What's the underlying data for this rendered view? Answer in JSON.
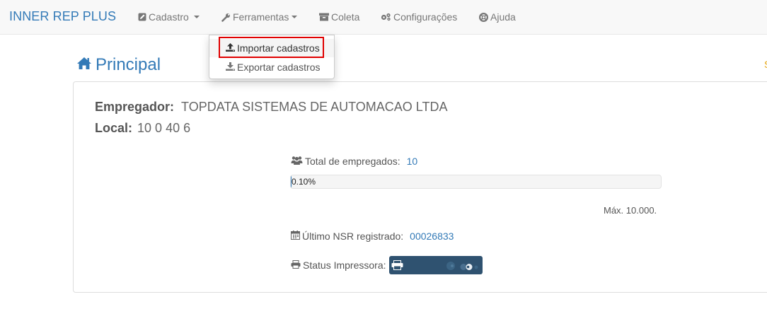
{
  "navbar": {
    "brand": "INNER REP PLUS",
    "items": [
      {
        "label": "Cadastro",
        "icon": "edit-icon",
        "has_caret": true
      },
      {
        "label": "Ferramentas",
        "icon": "wrench-icon",
        "has_caret": true
      },
      {
        "label": "Coleta",
        "icon": "archive-icon",
        "has_caret": false
      },
      {
        "label": "Configurações",
        "icon": "gears-icon",
        "has_caret": false
      },
      {
        "label": "Ajuda",
        "icon": "lifebuoy-icon",
        "has_caret": false
      }
    ]
  },
  "dropdown": {
    "items": [
      {
        "label": "Importar cadastros",
        "icon": "upload-icon",
        "highlighted": true
      },
      {
        "label": "Exportar cadastros",
        "icon": "download-icon",
        "highlighted": false
      }
    ]
  },
  "page": {
    "title": "Principal",
    "title_icon": "home-icon"
  },
  "panel": {
    "empregador_label": "Empregador:",
    "empregador_value": "TOPDATA SISTEMAS DE AUTOMACAO LTDA",
    "local_label": "Local:",
    "local_value": "10 0 40 6",
    "total_label": "Total de empregados:",
    "total_value": "10",
    "progress_text": "0.10%",
    "progress_fraction": 0.001,
    "max_text": "Máx. 10.000.",
    "nsr_label": "Último NSR registrado:",
    "nsr_value": "00026833",
    "printer_label": "Status Impressora:"
  },
  "colors": {
    "accent": "#337ab7",
    "highlight": "#e00000",
    "printer_bg": "#2f5270"
  }
}
